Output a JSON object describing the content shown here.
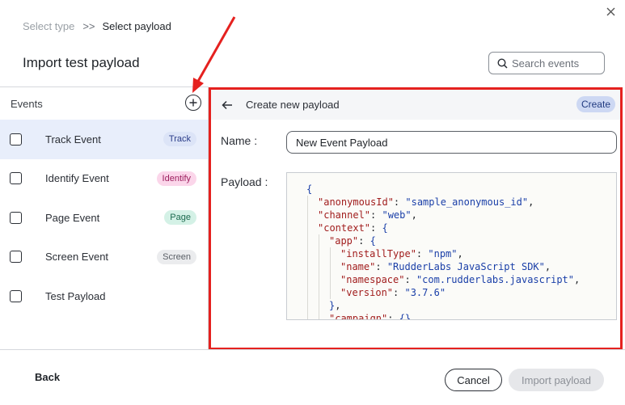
{
  "breadcrumb": {
    "step1": "Select type",
    "separator": ">>",
    "step2": "Select payload"
  },
  "title": "Import test payload",
  "search": {
    "placeholder": "Search events",
    "icon": "search-icon"
  },
  "sidebar": {
    "header": "Events",
    "add_icon": "plus-circle-icon",
    "items": [
      {
        "label": "Track Event",
        "badge": "Track",
        "selected": true
      },
      {
        "label": "Identify Event",
        "badge": "Identify",
        "selected": false
      },
      {
        "label": "Page Event",
        "badge": "Page",
        "selected": false
      },
      {
        "label": "Screen Event",
        "badge": "Screen",
        "selected": false
      },
      {
        "label": "Test Payload",
        "badge": "",
        "selected": false
      }
    ]
  },
  "panel": {
    "back_icon": "arrow-left-icon",
    "title": "Create new payload",
    "create_label": "Create",
    "name_label": "Name",
    "name_value": "New Event Payload",
    "payload_label": "Payload"
  },
  "footer": {
    "back_label": "Back",
    "cancel_label": "Cancel",
    "import_label": "Import payload"
  },
  "colors": {
    "highlight_border": "#e5211f",
    "selected_row": "#e8eefb",
    "track_badge": "#dce4f7",
    "identify_badge": "#fbd6ea",
    "page_badge": "#d4f1e6",
    "screen_badge": "#ebecee"
  }
}
